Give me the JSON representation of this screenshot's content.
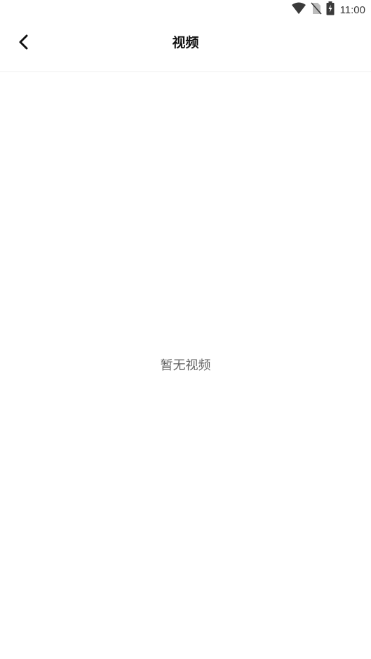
{
  "status_bar": {
    "time": "11:00",
    "icons": [
      "wifi-icon",
      "no-sim-icon",
      "battery-charging-icon"
    ]
  },
  "header": {
    "title": "视频",
    "back_icon": "chevron-left-icon"
  },
  "empty_state": {
    "message": "暂无视频"
  },
  "colors": {
    "background": "#ffffff",
    "title": "#111111",
    "empty_text": "#666666",
    "divider": "#efefef",
    "status_icon": "#3a3a3a"
  }
}
